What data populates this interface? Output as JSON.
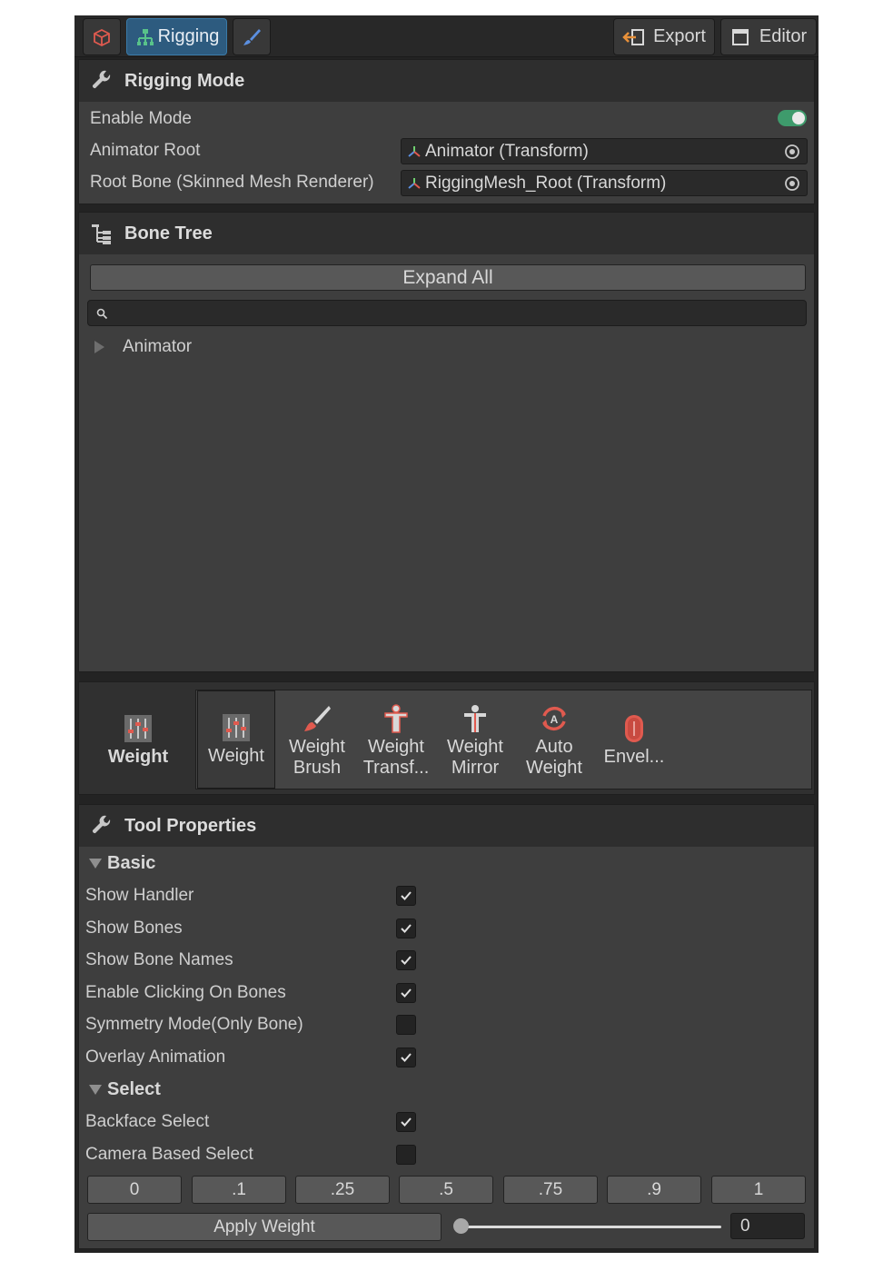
{
  "tabs": [
    {
      "icon": "mesh-cube-icon",
      "label": ""
    },
    {
      "icon": "rigging-hierarchy-icon",
      "label": "Rigging"
    },
    {
      "icon": "paint-brush-icon",
      "label": ""
    }
  ],
  "toolbar_right": {
    "export_label": "Export",
    "editor_label": "Editor"
  },
  "rigging_mode": {
    "title": "Rigging Mode",
    "enable_mode_label": "Enable Mode",
    "enable_mode_on": true,
    "animator_root_label": "Animator Root",
    "animator_root_value": "Animator (Transform)",
    "root_bone_label": "Root Bone (Skinned Mesh Renderer)",
    "root_bone_value": "RiggingMesh_Root (Transform)"
  },
  "bone_tree": {
    "title": "Bone Tree",
    "expand_all_label": "Expand All",
    "search_placeholder": "",
    "items": [
      {
        "label": "Animator",
        "expanded": false
      }
    ]
  },
  "tools": {
    "category_label": "Weight",
    "items": [
      {
        "label": "Weight",
        "icon": "weight-sliders-icon",
        "selected": true
      },
      {
        "label": "Weight Brush",
        "icon": "brush-icon",
        "selected": false
      },
      {
        "label": "Weight Transf...",
        "icon": "weight-transfer-icon",
        "selected": false
      },
      {
        "label": "Weight Mirror",
        "icon": "weight-mirror-icon",
        "selected": false
      },
      {
        "label": "Auto Weight",
        "icon": "auto-weight-icon",
        "selected": false
      },
      {
        "label": "Envel...",
        "icon": "envelope-icon",
        "selected": false
      }
    ]
  },
  "tool_properties": {
    "title": "Tool Properties",
    "basic_label": "Basic",
    "basic": [
      {
        "label": "Show Handler",
        "checked": true
      },
      {
        "label": "Show Bones",
        "checked": true
      },
      {
        "label": "Show Bone Names",
        "checked": true
      },
      {
        "label": "Enable Clicking On Bones",
        "checked": true
      },
      {
        "label": "Symmetry Mode(Only Bone)",
        "checked": false
      },
      {
        "label": "Overlay Animation",
        "checked": true
      }
    ],
    "select_label": "Select",
    "select": [
      {
        "label": "Backface Select",
        "checked": true
      },
      {
        "label": "Camera Based Select",
        "checked": false
      }
    ],
    "presets": [
      "0",
      ".1",
      ".25",
      ".5",
      ".75",
      ".9",
      "1"
    ],
    "apply_weight_label": "Apply Weight",
    "weight_value": "0"
  }
}
